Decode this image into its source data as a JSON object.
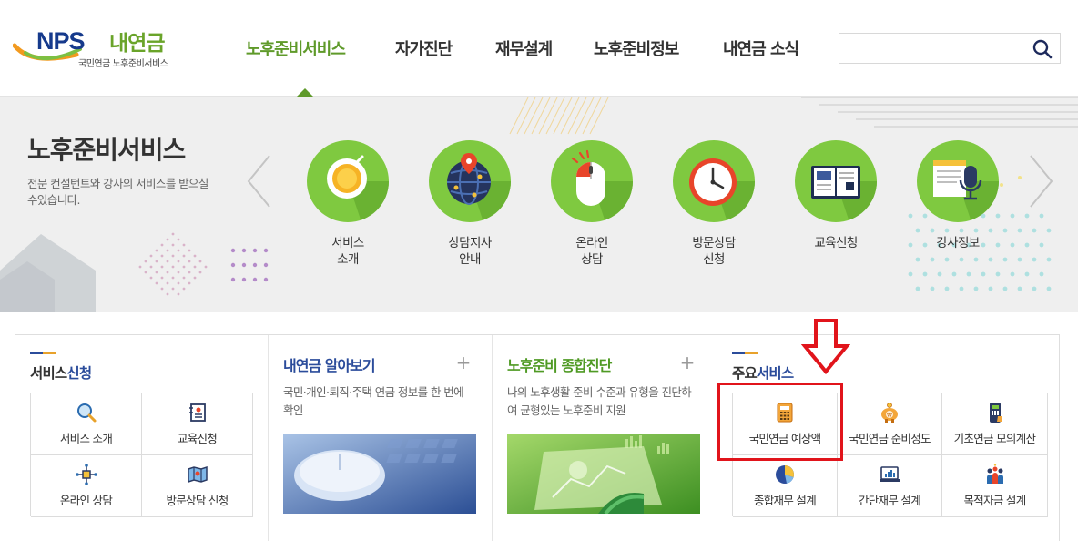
{
  "header": {
    "logo": {
      "brand": "NPS",
      "name": "내연금",
      "sub": "국민연금 노후준비서비스"
    },
    "nav": [
      {
        "label": "노후준비서비스",
        "active": true
      },
      {
        "label": "자가진단",
        "active": false
      },
      {
        "label": "재무설계",
        "active": false
      },
      {
        "label": "노후준비정보",
        "active": false
      },
      {
        "label": "내연금 소식",
        "active": false
      }
    ],
    "search": {
      "value": "",
      "placeholder": "",
      "icon": "search-icon"
    }
  },
  "banner": {
    "title": "노후준비서비스",
    "description": "전문 컨설턴트와 강사의 서비스를 받으실 수있습니다.",
    "services": [
      {
        "label": "서비스\n소개",
        "icon": "coin-icon"
      },
      {
        "label": "상담지사\n안내",
        "icon": "globe-pin-icon"
      },
      {
        "label": "온라인\n상담",
        "icon": "mouse-icon"
      },
      {
        "label": "방문상담\n신청",
        "icon": "clock-icon"
      },
      {
        "label": "교육신청",
        "icon": "book-icon"
      },
      {
        "label": "강사정보",
        "icon": "microphone-icon"
      }
    ],
    "colors": {
      "circle": "#7fc940",
      "shadow": "#6ab232"
    }
  },
  "sections": {
    "apply": {
      "title_prefix": "서비스",
      "title_hl": "신청",
      "items": [
        {
          "label": "서비스 소개",
          "icon": "magnifier-icon"
        },
        {
          "label": "교육신청",
          "icon": "notebook-icon"
        },
        {
          "label": "온라인 상담",
          "icon": "network-icon"
        },
        {
          "label": "방문상담 신청",
          "icon": "map-icon"
        }
      ]
    },
    "pension": {
      "title": "내연금 알아보기",
      "plus": "+",
      "description": "국민·개인·퇴직·주택 연금 정보를 한 번에 확인",
      "color": "#2b4c9b"
    },
    "diagnosis": {
      "title": "노후준비 종합진단",
      "plus": "+",
      "description": "나의 노후생활 준비 수준과 유형을 진단하여 균형있는 노후준비 지원",
      "color": "#4f9a24"
    },
    "main": {
      "title_prefix": "주요",
      "title_hl": "서비스",
      "items": [
        {
          "label": "국민연금 예상액",
          "icon": "calculator-icon"
        },
        {
          "label": "국민연금 준비정도",
          "icon": "piggy-bank-icon"
        },
        {
          "label": "기초연금 모의계산",
          "icon": "phone-calculator-icon"
        },
        {
          "label": "종합재무 설계",
          "icon": "pie-chart-icon"
        },
        {
          "label": "간단재무 설계",
          "icon": "laptop-chart-icon"
        },
        {
          "label": "목적자금 설계",
          "icon": "family-icon"
        }
      ]
    }
  },
  "annotation": {
    "color": "#e1141b",
    "target": "국민연금 예상액"
  }
}
